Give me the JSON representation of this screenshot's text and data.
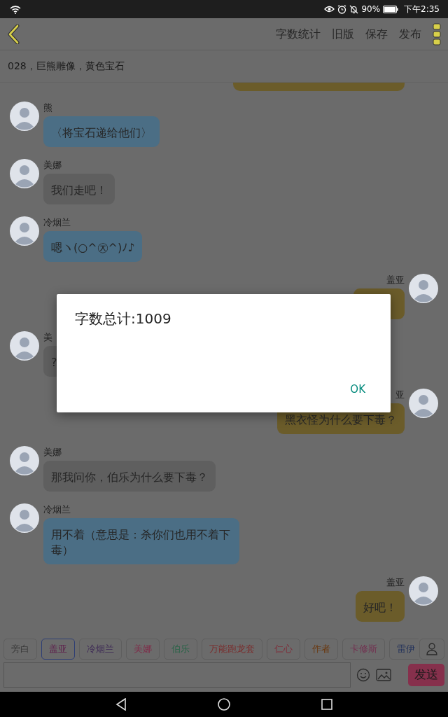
{
  "status_bar": {
    "battery": "90%",
    "time": "下午2:35"
  },
  "toolbar": {
    "actions": [
      "字数统计",
      "旧版",
      "保存",
      "发布"
    ]
  },
  "subtitle": "028，巨熊雕像，黄色宝石",
  "messages": [
    {
      "kind": "clipped",
      "color": "#6b5c2a"
    },
    {
      "kind": "incoming",
      "speaker": "熊",
      "text": "〈将宝石递给他们〉",
      "color": "#4b6e85"
    },
    {
      "kind": "incoming",
      "speaker": "美娜",
      "text": "我们走吧！",
      "color": "#5f5f5f"
    },
    {
      "kind": "incoming",
      "speaker": "冷烟兰",
      "text": "嗯ヽ(○^㉨^)ﾉ♪",
      "color": "#4b6e85"
    },
    {
      "kind": "outgoing",
      "speaker": "盖亚",
      "color": "#6b5c2a"
    },
    {
      "kind": "incoming",
      "speaker": "美",
      "text": "?",
      "color": "#5f5f5f"
    },
    {
      "kind": "outgoing",
      "speaker": "亚",
      "text": "黑衣怪为什么要下毒？",
      "color": "#6b5c2a"
    },
    {
      "kind": "incoming",
      "speaker": "美娜",
      "text": "那我问你，伯乐为什么要下毒？",
      "color": "#5f5f5f"
    },
    {
      "kind": "incoming",
      "speaker": "冷烟兰",
      "text": "用不着（意思是：杀你们也用不着下毒）",
      "color": "#4b6e85"
    },
    {
      "kind": "outgoing",
      "speaker": "盖亚",
      "text": "好吧！",
      "color": "#6b5c2a"
    }
  ],
  "characters": [
    {
      "label": "旁白",
      "color": "#3a3a3a",
      "selected": false
    },
    {
      "label": "盖亚",
      "color": "#5e1e4c",
      "selected": true
    },
    {
      "label": "冷烟兰",
      "color": "#3e2a56",
      "selected": false
    },
    {
      "label": "美娜",
      "color": "#7e2e4a",
      "selected": false
    },
    {
      "label": "伯乐",
      "color": "#2a6448",
      "selected": false
    },
    {
      "label": "万能跑龙套",
      "color": "#7a2e2e",
      "selected": false
    },
    {
      "label": "仁心",
      "color": "#7e2e3a",
      "selected": false
    },
    {
      "label": "作者",
      "color": "#6a3a12",
      "selected": false
    },
    {
      "label": "卡修斯",
      "color": "#723050",
      "selected": false
    },
    {
      "label": "雷伊",
      "color": "#1e2e5a",
      "selected": false
    }
  ],
  "composer": {
    "send": "发送"
  },
  "dialog": {
    "message": "字数总计:1009",
    "button": "OK"
  }
}
